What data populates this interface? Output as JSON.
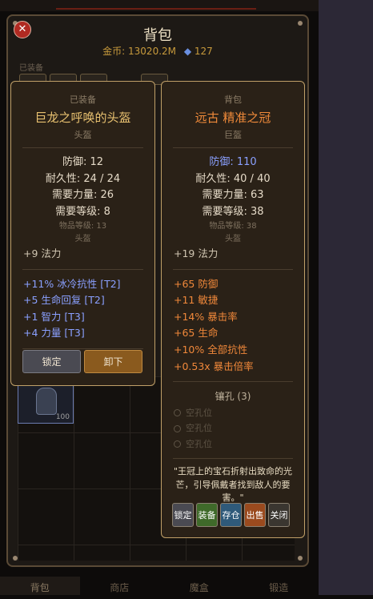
{
  "window": {
    "title": "背包",
    "gold_label": "金币: 13020.2M",
    "gem_count": "127",
    "equipped_section_label": "已装备"
  },
  "grid_item": {
    "count": "100"
  },
  "tabs": [
    {
      "label": "背包"
    },
    {
      "label": "商店"
    },
    {
      "label": "魔盒"
    },
    {
      "label": "锻造"
    }
  ],
  "equipped_tip": {
    "header": "已装备",
    "name": "巨龙之呼唤的头盔",
    "type": "头盔",
    "stats": [
      "防御: 12",
      "耐久性: 24 / 24",
      "需要力量: 26",
      "需要等级: 8"
    ],
    "item_level": "物品等级: 13",
    "type_again": "头盔",
    "implicit": "+9 法力",
    "affixes": [
      "+11% 冰冷抗性 [T2]",
      "+5 生命回复 [T2]",
      "+1 智力 [T3]",
      "+4 力量 [T3]"
    ],
    "lock_label": "锁定",
    "unequip_label": "卸下",
    "name_color": "#e8c170",
    "affix_color": "#8aa0ff"
  },
  "bag_tip": {
    "header": "背包",
    "name": "远古 精准之冠",
    "type": "巨盔",
    "defense": "防御: 110",
    "stats": [
      "耐久性: 40 / 40",
      "需要力量: 63",
      "需要等级: 38"
    ],
    "item_level": "物品等级: 38",
    "type_again": "头盔",
    "implicit": "+19 法力",
    "affixes": [
      "+65 防御",
      "+11 敏捷",
      "+14% 暴击率",
      "+65 生命",
      "+10% 全部抗性",
      "+0.53x 暴击倍率"
    ],
    "sockets_title": "镶孔 (3)",
    "sockets": [
      "空孔位",
      "空孔位",
      "空孔位"
    ],
    "flavor": "\"王冠上的宝石折射出致命的光芒，引导佩戴者找到敌人的要害。\"",
    "actions": [
      "锁定",
      "装备",
      "存仓",
      "出售",
      "关闭"
    ],
    "name_color": "#f08a3a",
    "affix_color": "#f0883a",
    "defense_color": "#8aa0ff"
  }
}
